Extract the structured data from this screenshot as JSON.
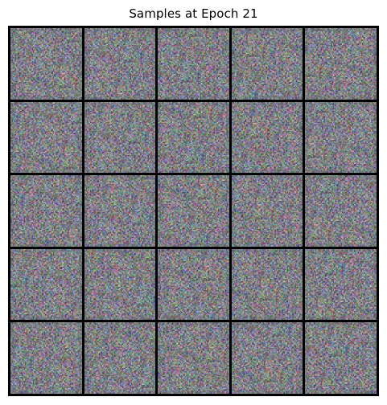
{
  "figure": {
    "title": "Samples at Epoch 21",
    "grid": {
      "rows": 5,
      "cols": 5
    },
    "sample_style": "gan-noise",
    "colors": {
      "background": "#ffffff",
      "grid_lines": "#000000",
      "noise_base": "#808587"
    }
  }
}
